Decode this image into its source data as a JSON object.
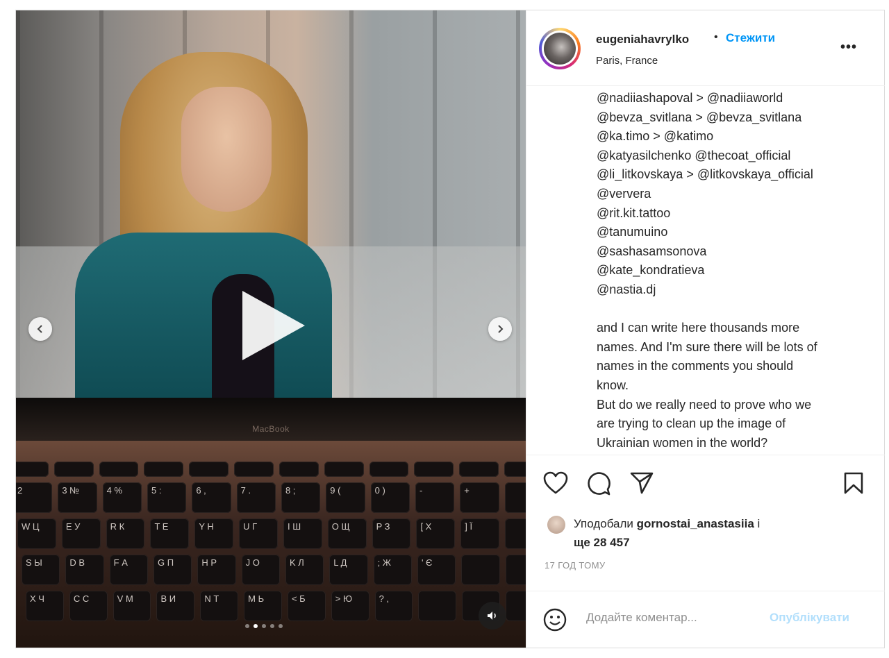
{
  "post": {
    "username": "eugeniahavrylko",
    "separator": "•",
    "follow_label": "Стежити",
    "location": "Paris, France",
    "more_label": "•••"
  },
  "media": {
    "macbook_label": "MacBook",
    "prev_icon": "chevron-left-icon",
    "next_icon": "chevron-right-icon",
    "play_icon": "play-icon",
    "sound_icon": "sound-icon",
    "carousel_count": 5,
    "carousel_active": 2,
    "keyboard_rows": [
      [
        "",
        "",
        "",
        "",
        "",
        "",
        "",
        "",
        "",
        "",
        "",
        ""
      ],
      [
        "2",
        "3 №",
        "4 %",
        "5 :",
        "6 ,",
        "7 .",
        "8 ;",
        "9 (",
        "0 )",
        "-",
        "+",
        ""
      ],
      [
        "W Ц",
        "E У",
        "R К",
        "T Е",
        "Y Н",
        "U Г",
        "I Ш",
        "O Щ",
        "P З",
        "[ Х",
        "] Ї",
        ""
      ],
      [
        "S Ы",
        "D В",
        "F А",
        "G П",
        "H Р",
        "J О",
        "K Л",
        "L Д",
        "; Ж",
        "' Є",
        "",
        ""
      ],
      [
        "X Ч",
        "C С",
        "V М",
        "B И",
        "N Т",
        "M Ь",
        "< Б",
        "> Ю",
        "? ,",
        "",
        "",
        ""
      ]
    ]
  },
  "caption": {
    "lines": [
      "@nadiiashapoval > @nadiiaworld",
      "@bevza_svitlana > @bevza_svitlana",
      "@ka.timo > @katimo",
      "@katyasilchenko @thecoat_official",
      "@li_litkovskaya > @litkovskaya_official",
      "@ververa",
      "@rit.kit.tattoo",
      "@tanumuino",
      "@sashasamsonova",
      "@kate_kondratieva",
      "@nastia.dj",
      "",
      "and I can write here thousands more",
      "names. And I'm sure there will be lots of",
      "names in the comments you should",
      "know.",
      "But do we really need to prove who we",
      "are trying to clean up the image of",
      "Ukrainian women in the world?"
    ]
  },
  "actions": {
    "like_icon": "heart-icon",
    "comment_icon": "comment-icon",
    "share_icon": "send-icon",
    "save_icon": "bookmark-icon"
  },
  "likes": {
    "prefix": "Уподобали",
    "user": "gornostai_anastasiia",
    "connector": "і",
    "rest": "ще 28 457"
  },
  "timestamp": "17 ГОД ТОМУ",
  "comment": {
    "emoji_icon": "emoji-icon",
    "placeholder": "Додайте коментар...",
    "publish_label": "Опублікувати"
  },
  "colors": {
    "accent": "#0095f6",
    "publish_disabled": "#b2dffc",
    "text": "#262626",
    "muted": "#8e8e8e"
  }
}
